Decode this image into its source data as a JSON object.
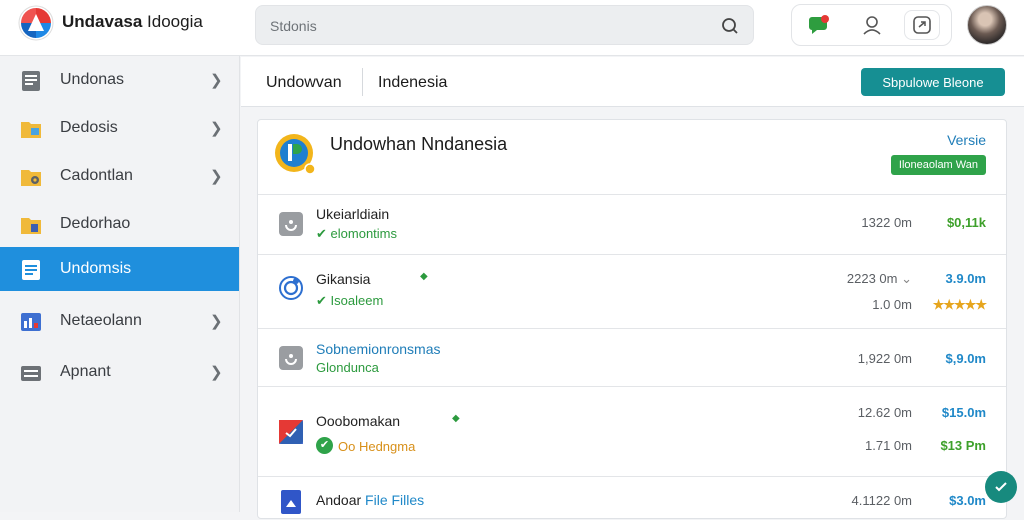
{
  "app": {
    "title_bold": "Undavasa",
    "title_rest": " Idoogia"
  },
  "search": {
    "placeholder": "Stdonis"
  },
  "sidebar": {
    "items": [
      {
        "label": "Undonas",
        "icon": "document-icon",
        "active": false
      },
      {
        "label": "Dedosis",
        "icon": "folder-icon",
        "active": false
      },
      {
        "label": "Cadontlan",
        "icon": "folder-settings-icon",
        "active": false
      },
      {
        "label": "Dedorhao",
        "icon": "folder-icon",
        "active": false
      },
      {
        "label": "Undomsis",
        "icon": "list-icon",
        "active": true
      },
      {
        "label": "Netaeolann",
        "icon": "chart-icon",
        "active": false
      },
      {
        "label": "Apnant",
        "icon": "drive-icon",
        "active": false
      }
    ]
  },
  "header": {
    "crumb1": "Undowvan",
    "crumb2": "Indenesia",
    "primary_button": "Sbpulowe Bleone"
  },
  "card": {
    "title": "Undowhan Nndanesia",
    "version": "Versie",
    "badge": "Iloneaolam Wan"
  },
  "rows": [
    {
      "name": "Ukeiarldiain",
      "sub": "elomontims",
      "meta1": "1322 0m",
      "price1": "$0,11k"
    },
    {
      "name": "Gikansia",
      "sub": "Isoaleem",
      "meta1": "2223 0m",
      "price1": "3.9.0m",
      "meta2": "1.0 0m",
      "rating": "★★★★★"
    },
    {
      "name": "Sobnemionronsmas",
      "sub": "Glondunca",
      "meta1": "1,922 0m",
      "price1": "$,9.0m"
    },
    {
      "name": "Ooobomakan",
      "sub": "Oo Hedngma",
      "meta1": "12.62 0m",
      "price1": "$15.0m",
      "meta2": "1.71 0m",
      "price2": "$13 Pm"
    },
    {
      "name_a": "Andoar",
      "name_b": "File Filles",
      "meta1": "4.1122 0m",
      "price1": "$3.0m"
    }
  ],
  "colors": {
    "accent": "#1f8fdd",
    "primary_button": "#168f93",
    "success": "#2fa34a",
    "link": "#1f7db8"
  }
}
